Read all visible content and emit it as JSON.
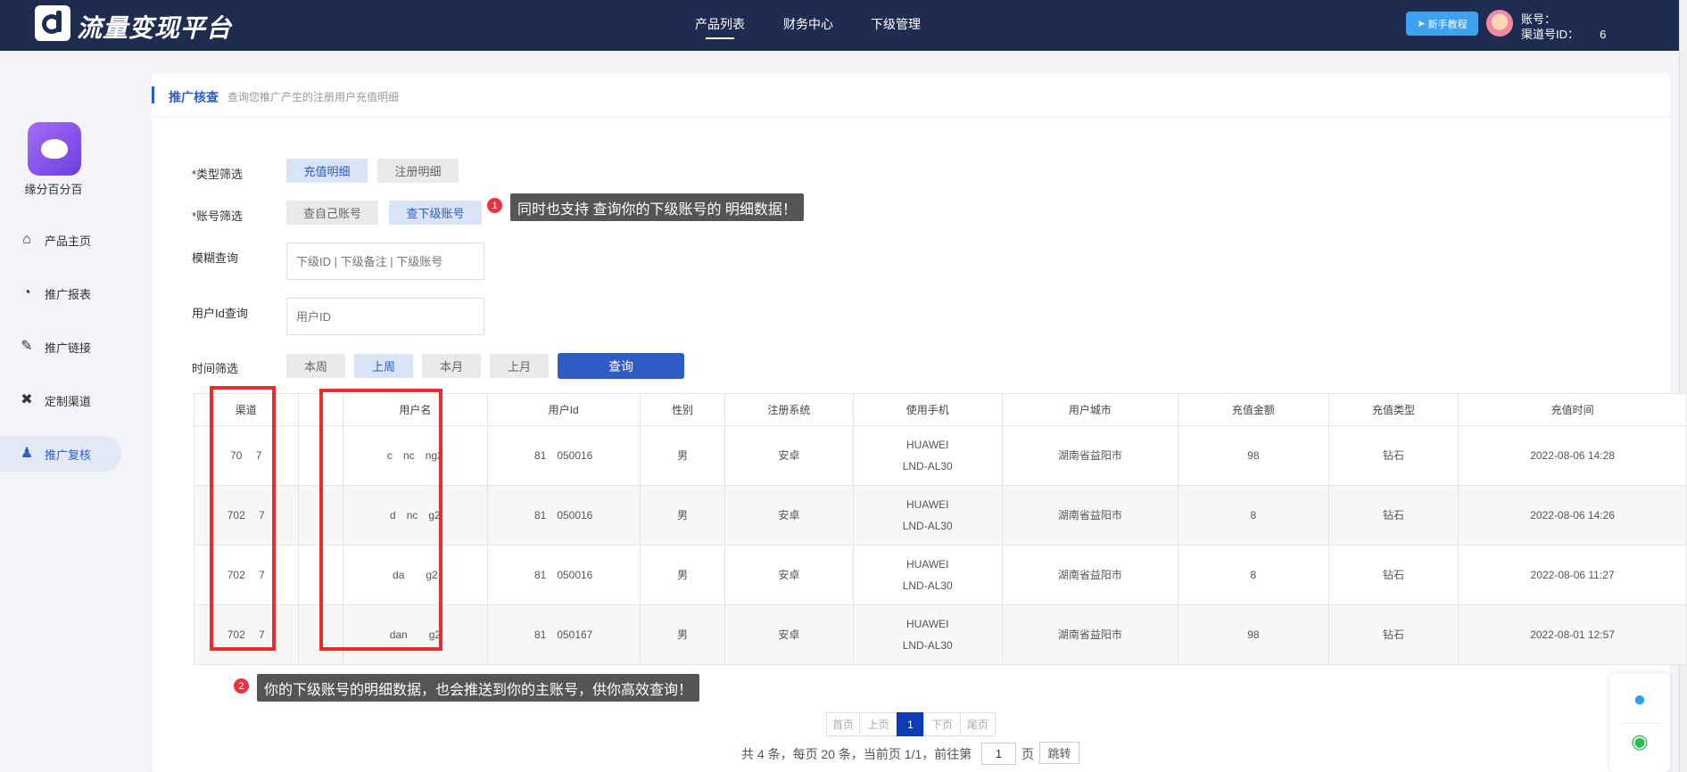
{
  "topbar": {
    "logo_text": "流量变现平台",
    "nav": [
      "产品列表",
      "财务中心",
      "下级管理"
    ],
    "guide_button": "新手教程",
    "account_line": "账号：　　",
    "channel_line": "渠道号ID：　　 6"
  },
  "sidebar": {
    "app_name": "缘分百分百",
    "items": [
      {
        "label": "产品主页",
        "icon": "home-icon"
      },
      {
        "label": "推广报表",
        "icon": "report-icon"
      },
      {
        "label": "推广链接",
        "icon": "link-icon"
      },
      {
        "label": "定制渠道",
        "icon": "tools-icon"
      },
      {
        "label": "推广复核",
        "icon": "user-icon"
      }
    ]
  },
  "card": {
    "title": "推广核查",
    "subtitle": "查询您推广产生的注册用户充值明细"
  },
  "filters": {
    "type_label": "*类型筛选",
    "type_options": [
      "充值明细",
      "注册明细"
    ],
    "account_label": "*账号筛选",
    "account_options": [
      "查自己账号",
      "查下级账号"
    ],
    "fuzzy_label": "模糊查询",
    "fuzzy_placeholder": "下级ID | 下级备注 | 下级账号",
    "userid_label": "用户Id查询",
    "userid_placeholder": "用户ID",
    "time_label": "时间筛选",
    "time_options": [
      "本周",
      "上周",
      "本月",
      "上月"
    ],
    "query_button": "查询"
  },
  "tips": [
    {
      "badge": "1",
      "text": "同时也支持 查询你的下级账号的 明细数据！"
    },
    {
      "badge": "2",
      "text": "你的下级账号的明细数据，也会推送到你的主账号，供你高效查询！"
    }
  ],
  "table": {
    "headers": [
      "渠道",
      "",
      "用户名",
      "用户Id",
      "性别",
      "注册系统",
      "使用手机",
      "用户城市",
      "充值金额",
      "充值类型",
      "充值时间"
    ],
    "rows": [
      {
        "channel": "70　 7",
        "username": "c　nc　ng2",
        "userid": "81　050016",
        "gender": "男",
        "os": "安卓",
        "phone1": "HUAWEI",
        "phone2": "LND-AL30",
        "city": "湖南省益阳市",
        "amount": "98",
        "type": "钻石",
        "time": "2022-08-06 14:28"
      },
      {
        "channel": "702　 7",
        "username": "d　nc　g2",
        "userid": "81　050016",
        "gender": "男",
        "os": "安卓",
        "phone1": "HUAWEI",
        "phone2": "LND-AL30",
        "city": "湖南省益阳市",
        "amount": "8",
        "type": "钻石",
        "time": "2022-08-06 14:26"
      },
      {
        "channel": "702　 7",
        "username": "da　　g2",
        "userid": "81　050016",
        "gender": "男",
        "os": "安卓",
        "phone1": "HUAWEI",
        "phone2": "LND-AL30",
        "city": "湖南省益阳市",
        "amount": "8",
        "type": "钻石",
        "time": "2022-08-06 11:27"
      },
      {
        "channel": "702　 7",
        "username": "dan　　g2",
        "userid": "81　050167",
        "gender": "男",
        "os": "安卓",
        "phone1": "HUAWEI",
        "phone2": "LND-AL30",
        "city": "湖南省益阳市",
        "amount": "98",
        "type": "钻石",
        "time": "2022-08-01 12:57"
      }
    ]
  },
  "pagination": {
    "first": "首页",
    "prev": "上页",
    "current": "1",
    "next": "下页",
    "last": "尾页",
    "info": "共 4 条，每页 20 条，当前页 1/1，前往第",
    "page_value": "1",
    "unit": "页",
    "jump": "跳转"
  },
  "colors": {
    "topbar_bg": "#1d2c4f",
    "accent": "#2f5bc4",
    "highlight_red": "#f02a2a"
  }
}
